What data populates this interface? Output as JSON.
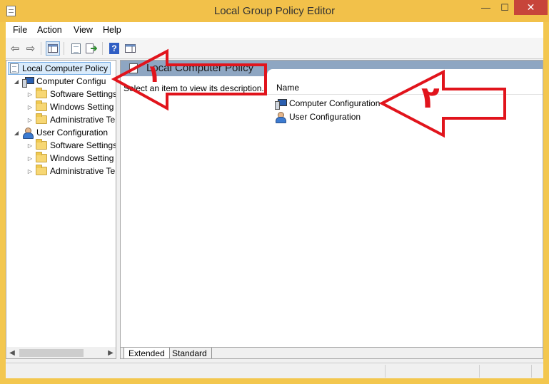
{
  "window": {
    "title": "Local Group Policy Editor",
    "minimize": "—",
    "maximize": "☐",
    "close": "✕"
  },
  "menu": [
    "File",
    "Action",
    "View",
    "Help"
  ],
  "toolbar": {
    "back": "⇦",
    "forward": "⇨"
  },
  "tree": {
    "root": "Local Computer Policy",
    "computer": {
      "label": "Computer Configu",
      "children": [
        "Software Settings",
        "Windows Setting",
        "Administrative Te"
      ]
    },
    "user": {
      "label": "User Configuration",
      "children": [
        "Software Settings",
        "Windows Setting",
        "Administrative Te"
      ]
    }
  },
  "detail": {
    "header": "Local Computer Policy",
    "description": "Select an item to view its description.",
    "column_name": "Name",
    "items": [
      "Computer Configuration",
      "User Configuration"
    ]
  },
  "tabs": [
    "Extended",
    "Standard"
  ],
  "annotations": {
    "arrow1_digit": "۱",
    "arrow2_digit": "۲",
    "color": "#e1141c"
  },
  "colors": {
    "titlebar": "#f2c14a",
    "close_button": "#c7453a",
    "detail_header": "#8ea6c2",
    "selection": "#d9ebfb"
  }
}
